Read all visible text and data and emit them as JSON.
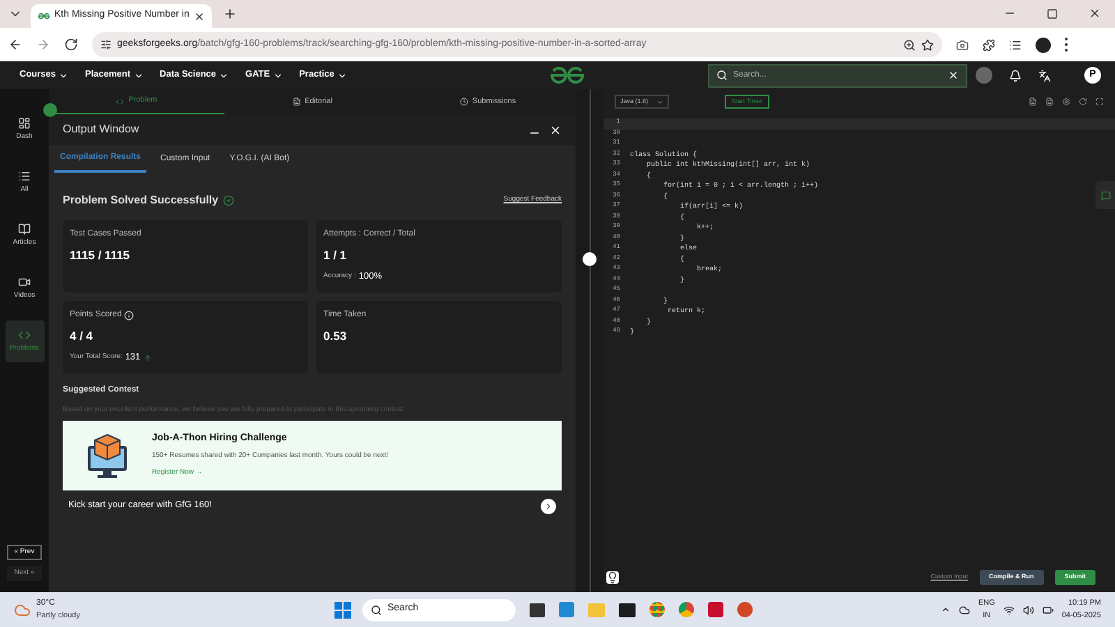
{
  "browser": {
    "tab_title": "Kth Missing Positive Number in",
    "url_host": "geeksforgeeks.org",
    "url_path": "/batch/gfg-160-problems/track/searching-gfg-160/problem/kth-missing-positive-number-in-a-sorted-array"
  },
  "nav": {
    "items": [
      "Courses",
      "Placement",
      "Data Science",
      "GATE",
      "Practice"
    ],
    "search": {
      "placeholder": "Search..."
    },
    "avatar": "P"
  },
  "sidebar": {
    "items": [
      {
        "label": "Dash",
        "selected": false
      },
      {
        "label": "All",
        "selected": false
      },
      {
        "label": "Articles",
        "selected": false
      },
      {
        "label": "Videos",
        "selected": false
      },
      {
        "label": "Problems",
        "selected": true
      }
    ],
    "prev": "« Prev",
    "next": "Next »"
  },
  "problem_tabs": [
    {
      "label": "Problem",
      "selected": true
    },
    {
      "label": "Editorial",
      "selected": false
    },
    {
      "label": "Submissions",
      "selected": false
    }
  ],
  "output": {
    "title": "Output Window",
    "tabs": [
      {
        "label": "Compilation Results",
        "selected": true
      },
      {
        "label": "Custom Input",
        "selected": false
      },
      {
        "label": "Y.O.G.I. (AI Bot)",
        "selected": false
      }
    ],
    "status": "Problem Solved Successfully",
    "feedback": "Suggest Feedback",
    "cards": [
      {
        "label": "Test Cases Passed",
        "value": "1115 / 1115"
      },
      {
        "label": "Attempts : Correct / Total",
        "value": "1 / 1",
        "note_label": "Accuracy :",
        "note_value": "100%"
      },
      {
        "label": "Points Scored",
        "value": "4 / 4",
        "note_label": "Your Total Score:",
        "note_value": "131",
        "info": true,
        "up": true
      },
      {
        "label": "Time Taken",
        "value": "0.53"
      }
    ],
    "suggested": {
      "title": "Suggested Contest",
      "text": "Based on your excellent performance, we believe you are fully prepared to participate in this upcoming contest.",
      "card": {
        "title": "Job-A-Thon Hiring Challenge",
        "text": "150+ Resumes shared with 20+ Companies last month. Yours could be next!",
        "link": "Register Now →"
      }
    },
    "kick": "Kick start your career with GfG 160!"
  },
  "editor": {
    "language": "Java (1.8)",
    "timer": "Start Timer",
    "lines": [
      {
        "no": "1"
      },
      {
        "no": "30"
      },
      {
        "no": "31"
      },
      {
        "no": "32",
        "text": "class Solution {"
      },
      {
        "no": "33",
        "text": "    public int kthMissing(int[] arr, int k)"
      },
      {
        "no": "34",
        "text": "    {"
      },
      {
        "no": "35",
        "text": "        for(int i = 0 ; i < arr.length ; i++)"
      },
      {
        "no": "36",
        "text": "        {"
      },
      {
        "no": "37",
        "text": "            if(arr[i] <= k)"
      },
      {
        "no": "38",
        "text": "            {"
      },
      {
        "no": "39",
        "text": "                k++;"
      },
      {
        "no": "40",
        "text": "            }"
      },
      {
        "no": "41",
        "text": "            else"
      },
      {
        "no": "42",
        "text": "            {"
      },
      {
        "no": "43",
        "text": "                break;"
      },
      {
        "no": "44",
        "text": "            }"
      },
      {
        "no": "45"
      },
      {
        "no": "46",
        "text": "        }"
      },
      {
        "no": "47",
        "text": "         return k;"
      },
      {
        "no": "48",
        "text": "    }"
      },
      {
        "no": "49",
        "text": "}"
      }
    ],
    "custom_input": "Custom Input",
    "compile": "Compile & Run",
    "submit": "Submit"
  },
  "taskbar": {
    "temp": "30°C",
    "weather": "Partly cloudy",
    "search": "Search",
    "lang": "ENG",
    "region": "IN",
    "time": "10:19 PM",
    "date": "04-05-2025"
  }
}
